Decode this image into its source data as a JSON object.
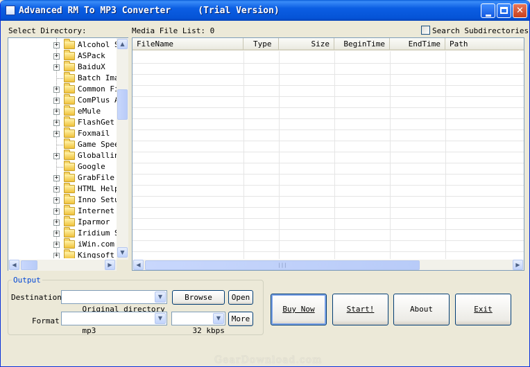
{
  "window": {
    "title": "Advanced RM To MP3 Converter     (Trial Version)"
  },
  "directory": {
    "label": "Select Directory:",
    "items": [
      {
        "label": "Alcohol S",
        "expandable": true
      },
      {
        "label": "ASPack",
        "expandable": true
      },
      {
        "label": "BaiduX",
        "expandable": true
      },
      {
        "label": "Batch Ima",
        "expandable": false
      },
      {
        "label": "Common Fi",
        "expandable": true
      },
      {
        "label": "ComPlus A",
        "expandable": true
      },
      {
        "label": "eMule",
        "expandable": true
      },
      {
        "label": "FlashGet",
        "expandable": true
      },
      {
        "label": "Foxmail",
        "expandable": true
      },
      {
        "label": "Game Spee",
        "expandable": false
      },
      {
        "label": "Globallin",
        "expandable": true
      },
      {
        "label": "Google",
        "expandable": false
      },
      {
        "label": "GrabFile",
        "expandable": true
      },
      {
        "label": "HTML Help",
        "expandable": true
      },
      {
        "label": "Inno Setu",
        "expandable": true
      },
      {
        "label": "Internet",
        "expandable": true
      },
      {
        "label": "Iparmor",
        "expandable": true
      },
      {
        "label": "Iridium S",
        "expandable": true
      },
      {
        "label": "iWin.com",
        "expandable": true
      },
      {
        "label": "Kingsoft",
        "expandable": true
      }
    ]
  },
  "media_list": {
    "label": "Media File List: 0",
    "search_subdirectories": "Search Subdirectories",
    "search_checked": false,
    "columns": [
      "FileName",
      "Type",
      "Size",
      "BeginTime",
      "EndTime",
      "Path"
    ]
  },
  "output": {
    "group_title": "Output",
    "destination_label": "Destination:",
    "destination_value": "Original directory",
    "format_label": "Format:",
    "format_value": "mp3",
    "bitrate_value": "32 kbps",
    "browse": "Browse",
    "open": "Open",
    "more": "More"
  },
  "actions": {
    "buy_now": "Buy Now",
    "start": "Start!",
    "about": "About",
    "exit": "Exit"
  },
  "watermark": "GearDownload.com",
  "icons": {
    "minimize": "minimize-icon",
    "maximize": "maximize-icon",
    "close": "close-icon",
    "folder": "folder-icon"
  }
}
